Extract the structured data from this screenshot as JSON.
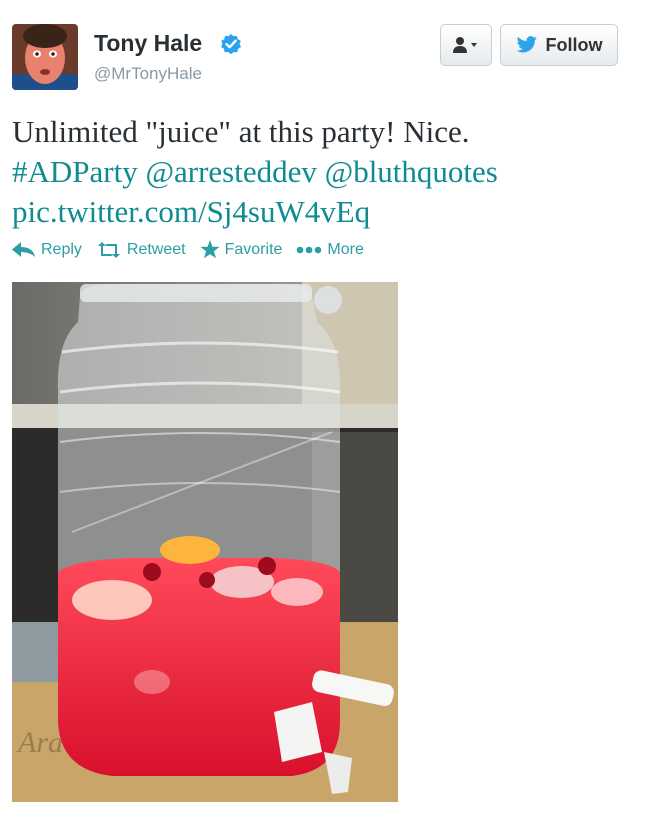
{
  "user": {
    "name": "Tony Hale",
    "handle": "@MrTonyHale",
    "verified_icon": "verified-badge-icon"
  },
  "buttons": {
    "user_menu_icon": "user-dropdown-icon",
    "follow_label": "Follow"
  },
  "tweet": {
    "line1": "Unlimited \"juice\" at this party!  Nice.",
    "hashtag": "#ADParty",
    "mention1": "@arresteddev",
    "mention2": "@bluthquotes",
    "link": "pic.twitter.com/Sj4suW4vEq"
  },
  "actions": {
    "reply": "Reply",
    "retweet": "Retweet",
    "favorite": "Favorite",
    "more": "More"
  },
  "colors": {
    "link": "#0f8c91",
    "action": "#2b9ea5",
    "verified": "#2aa3ef",
    "twitter_bird": "#2ea4e8"
  }
}
